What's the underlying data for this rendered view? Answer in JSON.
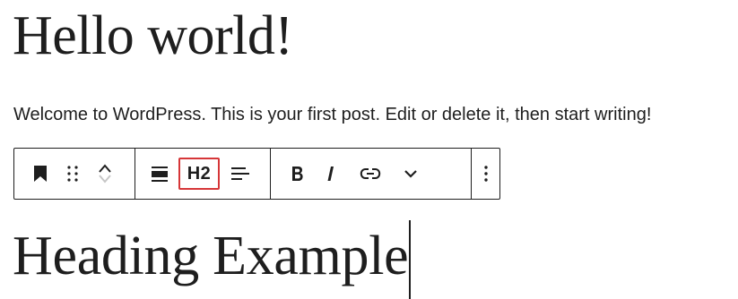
{
  "post": {
    "title": "Hello world!",
    "paragraph": "Welcome to WordPress. This is your first post. Edit or delete it, then start writing!",
    "heading": "Heading Example"
  },
  "toolbar": {
    "heading_level_label": "H2",
    "icons": [
      "bookmark-icon",
      "drag-handle-icon",
      "move-up-down-icon",
      "align-wide-icon",
      "heading-level-button",
      "text-align-left-icon",
      "bold-icon",
      "italic-icon",
      "link-icon",
      "chevron-down-icon",
      "more-options-icon"
    ],
    "highlight_color": "#d63638"
  }
}
